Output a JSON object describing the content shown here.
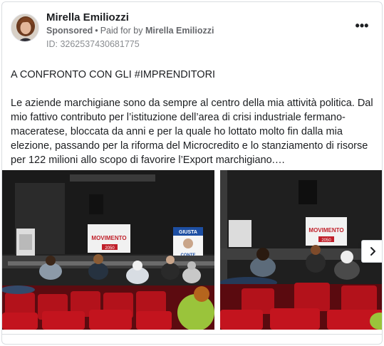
{
  "post": {
    "author": "Mirella Emiliozzi",
    "sponsored_label": "Sponsored",
    "separator": "•",
    "paid_for_label": "Paid for by",
    "payer": "Mirella Emiliozzi",
    "ad_id": "ID: 3262537430681775",
    "more_label": "•••",
    "title": "A CONFRONTO CON GLI #IMPRENDITORI",
    "body": "Le aziende marchigiane sono da sempre al centro della mia attività politica. Dal mio fattivo contributo per l’istituzione dell’area di crisi industriale fermano-maceratese, bloccata da anni e per la quale ho lottato molto fin dalla mia elezione, passando per la riforma del Microcredito e lo stanziamento di risorse per 122 milioni allo scopo di favorire l’Export marchigiano.…"
  },
  "carousel": {
    "slides": [
      {
        "banner_left": "MOVIMENTO",
        "banner_right": "GIUSTA",
        "banner_right_sub": "CONTE",
        "number": "2050"
      },
      {
        "banner": "MOVIMENTO",
        "number": "2050"
      }
    ],
    "next_icon": "chevron-right-icon"
  },
  "colors": {
    "text": "#1c1e21",
    "secondary": "#65676b",
    "seat_red": "#b3121b",
    "stage_dark": "#2a2a2a"
  }
}
